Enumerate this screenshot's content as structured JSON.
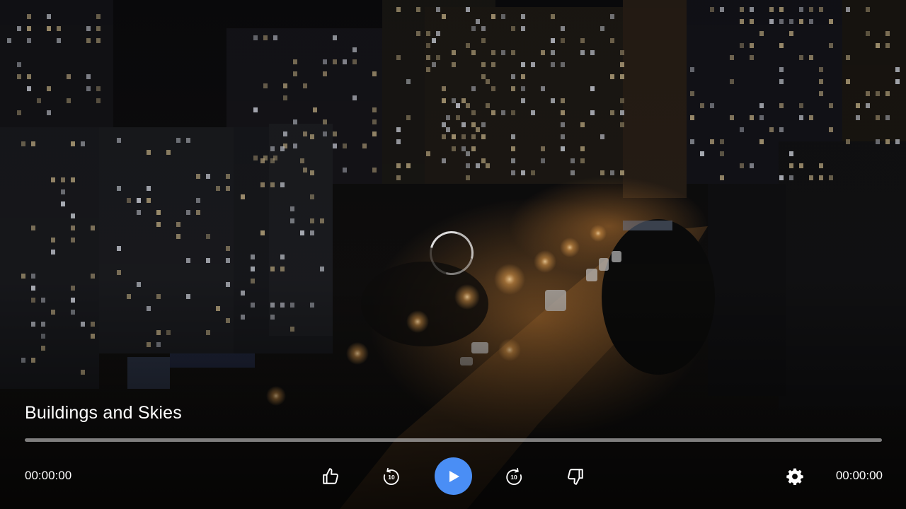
{
  "video": {
    "title": "Buildings and Skies",
    "progress_fraction": 0,
    "loading": true
  },
  "controls": {
    "current_time": "00:00:00",
    "total_time": "00:00:00",
    "buttons": [
      {
        "name": "like-button",
        "icon": "thumbs-up-icon"
      },
      {
        "name": "rewind-10-button",
        "icon": "rewind-10-icon"
      },
      {
        "name": "play-button",
        "icon": "play-icon"
      },
      {
        "name": "forward-10-button",
        "icon": "forward-10-icon"
      },
      {
        "name": "dislike-button",
        "icon": "thumbs-down-icon"
      },
      {
        "name": "settings-button",
        "icon": "gear-icon"
      }
    ],
    "skip_seconds": "10"
  },
  "colors": {
    "accent": "#4a8ef5",
    "text": "#ffffff",
    "track": "#c8c8c8"
  }
}
